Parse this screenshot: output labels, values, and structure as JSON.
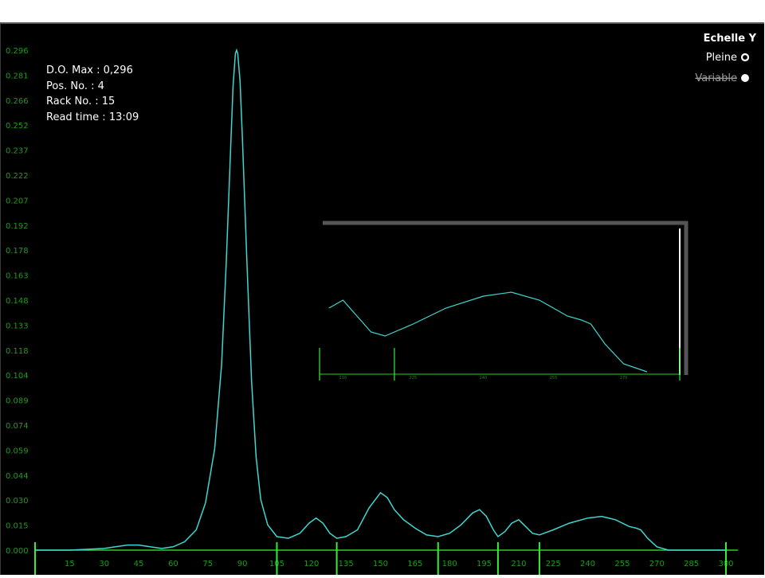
{
  "info": {
    "do_max": "D.O. Max : 0,296",
    "pos_no": "Pos. No.   : 4",
    "rack_no": "Rack No.  : 15",
    "read_time": "Read time : 13:09"
  },
  "legend": {
    "title": "Echelle Y",
    "option_full": "Pleine",
    "option_variable": "Variable",
    "selected": "Pleine"
  },
  "colors": {
    "background": "#000000",
    "trace": "#3fd6d0",
    "axis": "#2ecc2e",
    "fraction_marker": "#33ee33",
    "tick_text": "#1f9a1f"
  },
  "chart_data": {
    "type": "line",
    "title": "",
    "xlabel": "",
    "ylabel": "",
    "xlim": [
      0,
      300
    ],
    "ylim": [
      0,
      0.296
    ],
    "y_ticks": [
      "0.296",
      "0.281",
      "0.266",
      "0.252",
      "0.237",
      "0.222",
      "0.207",
      "0.192",
      "0.178",
      "0.163",
      "0.148",
      "0.133",
      "0.118",
      "0.104",
      "0.089",
      "0.074",
      "0.059",
      "0.044",
      "0.030",
      "0.015",
      "0.000"
    ],
    "x_ticks": [
      "15",
      "30",
      "45",
      "60",
      "75",
      "90",
      "105",
      "120",
      "135",
      "150",
      "165",
      "180",
      "195",
      "210",
      "225",
      "240",
      "255",
      "270",
      "285",
      "300"
    ],
    "fraction_markers_x": [
      0,
      105,
      131,
      175,
      201,
      219,
      300
    ],
    "series": [
      {
        "points": [
          [
            0,
            0.0
          ],
          [
            15,
            0.0
          ],
          [
            30,
            0.001
          ],
          [
            40,
            0.003
          ],
          [
            45,
            0.003
          ],
          [
            50,
            0.002
          ],
          [
            55,
            0.001
          ],
          [
            60,
            0.002
          ],
          [
            65,
            0.005
          ],
          [
            70,
            0.012
          ],
          [
            74,
            0.028
          ],
          [
            78,
            0.06
          ],
          [
            81,
            0.11
          ],
          [
            83,
            0.17
          ],
          [
            85,
            0.24
          ],
          [
            86,
            0.275
          ],
          [
            87,
            0.294
          ],
          [
            87.5,
            0.296
          ],
          [
            88,
            0.294
          ],
          [
            89,
            0.278
          ],
          [
            90,
            0.245
          ],
          [
            92,
            0.17
          ],
          [
            94,
            0.1
          ],
          [
            96,
            0.055
          ],
          [
            98,
            0.03
          ],
          [
            101,
            0.015
          ],
          [
            105,
            0.008
          ],
          [
            110,
            0.007
          ],
          [
            115,
            0.01
          ],
          [
            119,
            0.016
          ],
          [
            122,
            0.019
          ],
          [
            125,
            0.016
          ],
          [
            128,
            0.01
          ],
          [
            131,
            0.007
          ],
          [
            135,
            0.008
          ],
          [
            140,
            0.012
          ],
          [
            145,
            0.025
          ],
          [
            150,
            0.034
          ],
          [
            153,
            0.031
          ],
          [
            156,
            0.024
          ],
          [
            160,
            0.018
          ],
          [
            165,
            0.013
          ],
          [
            170,
            0.009
          ],
          [
            175,
            0.008
          ],
          [
            180,
            0.01
          ],
          [
            185,
            0.015
          ],
          [
            190,
            0.022
          ],
          [
            193,
            0.024
          ],
          [
            196,
            0.02
          ],
          [
            199,
            0.012
          ],
          [
            201,
            0.008
          ],
          [
            204,
            0.011
          ],
          [
            207,
            0.016
          ],
          [
            210,
            0.018
          ],
          [
            213,
            0.014
          ],
          [
            216,
            0.01
          ],
          [
            219,
            0.009
          ],
          [
            225,
            0.012
          ],
          [
            232,
            0.016
          ],
          [
            240,
            0.019
          ],
          [
            246,
            0.02
          ],
          [
            252,
            0.018
          ],
          [
            258,
            0.014
          ],
          [
            261,
            0.013
          ],
          [
            263,
            0.012
          ],
          [
            266,
            0.007
          ],
          [
            270,
            0.002
          ],
          [
            275,
            0.0
          ],
          [
            285,
            0.0
          ],
          [
            300,
            0.0
          ]
        ]
      }
    ],
    "inset": {
      "xlim": [
        205,
        282
      ],
      "x_ticks": [
        "210",
        "225",
        "240",
        "255",
        "270"
      ],
      "fraction_markers_x": [
        205,
        221,
        282
      ]
    }
  }
}
